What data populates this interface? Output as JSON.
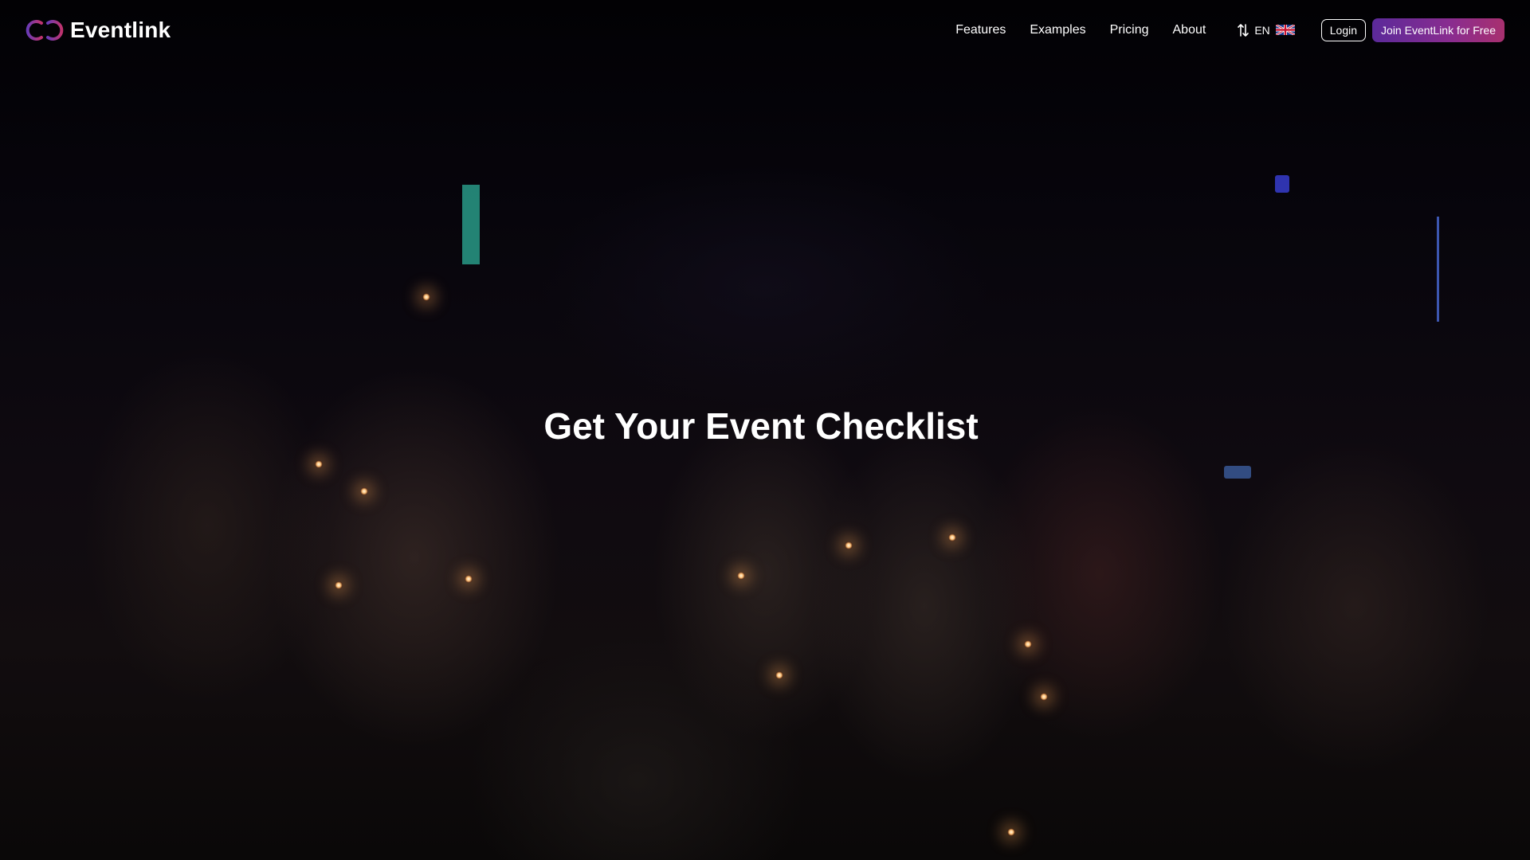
{
  "brand": {
    "name": "Eventlink",
    "logo_icon": "eventlink-logo-icon",
    "accent_color": "#8a2c8f"
  },
  "nav": {
    "links": [
      {
        "label": "Features"
      },
      {
        "label": "Examples"
      },
      {
        "label": "Pricing"
      },
      {
        "label": "About"
      }
    ],
    "language": {
      "code": "EN",
      "icon": "sort-arrows-icon",
      "flag": "uk-flag-icon"
    },
    "login_label": "Login",
    "join_label": "Join EventLink for Free"
  },
  "hero": {
    "title": "Get Your Event Checklist",
    "background": "party-sparklers-photo"
  }
}
